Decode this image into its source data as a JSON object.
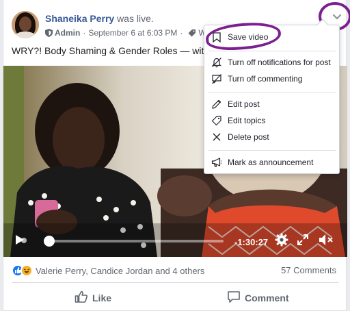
{
  "post": {
    "author": "Shaneika Perry",
    "author_suffix": "was live.",
    "role": "Admin",
    "date": "September 6 at 6:03 PM",
    "separator": "·",
    "topic_prefix": "W",
    "text": "WRY?! Body Shaming & Gender Roles — wit"
  },
  "video": {
    "time_remaining": "-1:30:27",
    "progress_fraction": 0.02
  },
  "engagement": {
    "reactors": "Valerie Perry, Candice Jordan and 4 others",
    "comments": "57 Comments"
  },
  "actions": {
    "like": "Like",
    "comment": "Comment"
  },
  "menu": {
    "save_video": "Save video",
    "turn_off_notifications": "Turn off notifications for post",
    "turn_off_commenting": "Turn off commenting",
    "edit_post": "Edit post",
    "edit_topics": "Edit topics",
    "delete_post": "Delete post",
    "mark_announcement": "Mark as announcement"
  },
  "colors": {
    "annotation": "#7c1f8f",
    "link": "#385898",
    "like_blue": "#1877f2"
  },
  "icons": {
    "options": "chevron-down-icon",
    "save": "bookmark-icon",
    "notifications_off": "bell-off-icon",
    "commenting_off": "comment-off-icon",
    "edit": "pencil-icon",
    "topics": "tag-icon",
    "delete": "x-icon",
    "announcement": "megaphone-icon"
  }
}
